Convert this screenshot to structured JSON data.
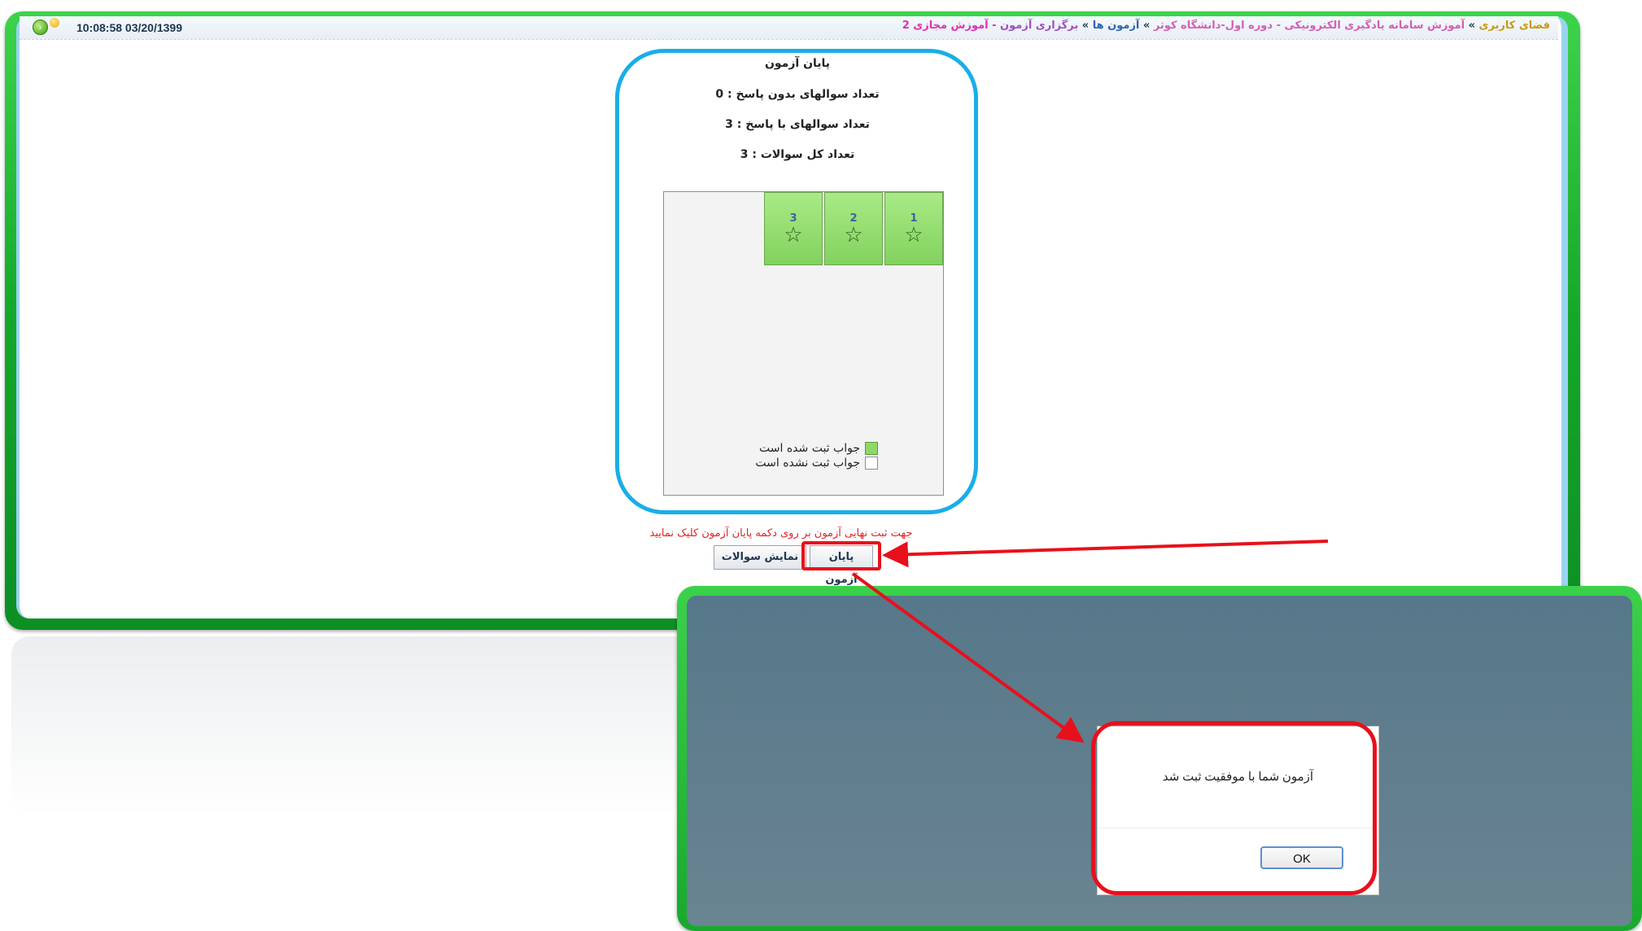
{
  "header": {
    "datetime": "10:08:58 03/20/1399",
    "breadcrumb": [
      {
        "text": "فضای کاربری",
        "cls": "bc-a"
      },
      {
        "text": " » ",
        "cls": "bc-sep"
      },
      {
        "text": "آموزش سامانه یادگیری الکترونیکی - دوره اول-دانشگاه کوثر",
        "cls": "bc-b"
      },
      {
        "text": " » ",
        "cls": "bc-sep"
      },
      {
        "text": "آزمون ها",
        "cls": "bc-c"
      },
      {
        "text": " » ",
        "cls": "bc-sep"
      },
      {
        "text": "برگزاری آزمون",
        "cls": "bc-d"
      },
      {
        "text": " - آموزش مجازی 2",
        "cls": "bc-e"
      }
    ]
  },
  "summary": {
    "title": "پایان آزمون",
    "unanswered": "تعداد سوالهای بدون پاسخ : 0",
    "answered": "تعداد سوالهای با پاسخ : 3",
    "total": "تعداد کل سوالات : 3"
  },
  "questions": [
    {
      "number": "1",
      "icon": "star-outline-icon"
    },
    {
      "number": "2",
      "icon": "star-outline-icon"
    },
    {
      "number": "3",
      "icon": "star-outline-icon"
    }
  ],
  "legend": {
    "answered": "جواب ثبت شده است",
    "unanswered": "جواب ثبت نشده است",
    "answered_color": "#8ed868",
    "unanswered_color": "#ffffff"
  },
  "note": "جهت ثبت نهایی آزمون بر روی دکمه پایان آزمون کلیک نمایید",
  "buttons": {
    "end_exam": "پایان آزمون",
    "show_questions": "نمایش سوالات"
  },
  "dialog": {
    "message": "آزمون شما با موفقیت ثبت شد",
    "ok": "OK"
  },
  "colors": {
    "frame_green": "#17aa2c",
    "highlight_red": "#e8101c",
    "outline_blue": "#19aee8"
  }
}
